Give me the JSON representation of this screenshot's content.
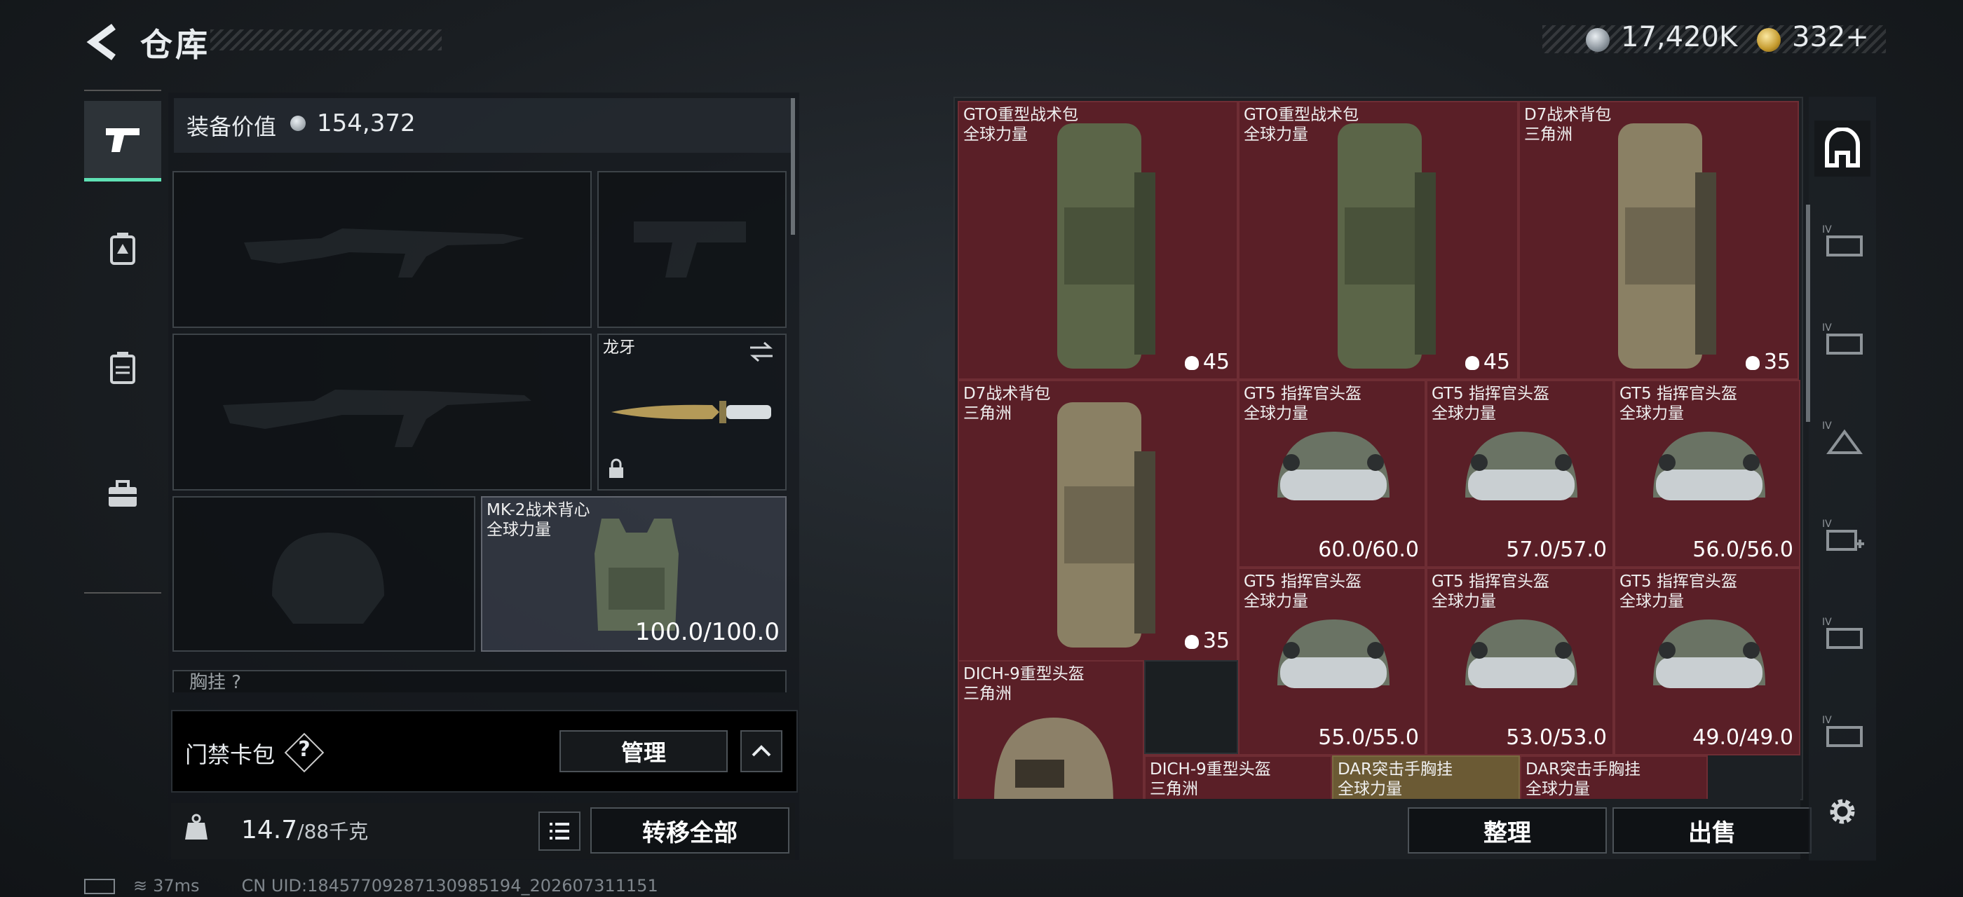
{
  "header": {
    "title": "仓库",
    "currency_silver": "17,420K",
    "currency_gold": "332",
    "gold_add": "+"
  },
  "equipment": {
    "value_label": "装备价值",
    "value": "154,372",
    "melee": {
      "name": "龙牙"
    },
    "armor": {
      "name": "MK-2战术背心",
      "region": "全球力量",
      "durability": "100.0/100.0"
    },
    "chest_label": "胸挂 ?"
  },
  "keycard": {
    "label": "门禁卡包",
    "help": "?",
    "manage": "管理"
  },
  "weight": {
    "value": "14.7",
    "max": "/88千克",
    "transfer_all": "转移全部"
  },
  "storage": {
    "items": [
      {
        "name": "GTO重型战术包",
        "region": "全球力量",
        "count": "45"
      },
      {
        "name": "GTO重型战术包",
        "region": "全球力量",
        "count": "45"
      },
      {
        "name": "D7战术背包",
        "region": "三角洲",
        "count": "35"
      },
      {
        "name": "D7战术背包",
        "region": "三角洲",
        "count": "35"
      },
      {
        "name": "GT5 指挥官头盔",
        "region": "全球力量",
        "durability": "60.0/60.0"
      },
      {
        "name": "GT5 指挥官头盔",
        "region": "全球力量",
        "durability": "57.0/57.0"
      },
      {
        "name": "GT5 指挥官头盔",
        "region": "全球力量",
        "durability": "56.0/56.0"
      },
      {
        "name": "GT5 指挥官头盔",
        "region": "全球力量",
        "durability": "55.0/55.0"
      },
      {
        "name": "GT5 指挥官头盔",
        "region": "全球力量",
        "durability": "53.0/53.0"
      },
      {
        "name": "GT5 指挥官头盔",
        "region": "全球力量",
        "durability": "49.0/49.0"
      },
      {
        "name": "DICH-9重型头盔",
        "region": "三角洲"
      },
      {
        "name": "DICH-9重型头盔",
        "region": "三角洲"
      },
      {
        "name": "DAR突击手胸挂",
        "region": "全球力量"
      },
      {
        "name": "DAR突击手胸挂",
        "region": "全球力量"
      }
    ],
    "sort": "整理",
    "sell": "出售"
  },
  "status": {
    "ping": "37ms",
    "uid": "CN UID:18457709287130985194_202607311151"
  },
  "colors": {
    "item_red": "#5a1f27",
    "accent_green": "#5fe1b4",
    "item_tan": "#6b5a34"
  }
}
